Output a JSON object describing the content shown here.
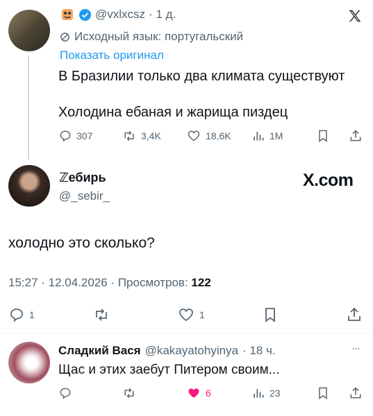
{
  "parent_tweet": {
    "handle": "@vxlxcsz",
    "time": "1 д.",
    "translated_label": "Исходный язык: португальский",
    "show_original": "Показать оригинал",
    "text_line1": "В Бразилии только два климата существуют",
    "text_line2": "Холодина ебаная и жарища пиздец",
    "replies": "307",
    "reposts": "3,4K",
    "likes": "18,6K",
    "views": "1M"
  },
  "main_tweet": {
    "name": "ℤебирь",
    "handle": "@_sebir_",
    "brand": "X.com",
    "text": "холодно это сколько?",
    "timestamp": "15:27 · 12.04.2026 · Просмотров: ",
    "views_count": "122",
    "replies": "1",
    "likes": "1"
  },
  "reply_tweet": {
    "name": "Сладкий Вася",
    "handle": "@kakayatohyinya",
    "time": "· 18 ч.",
    "text": "Щас и этих заебут Питером своим...",
    "likes": "6",
    "views": "23",
    "more": "···"
  },
  "colors": {
    "text": "#0f1419",
    "gray": "#536471",
    "link": "#1d9bf0",
    "like": "#f91880",
    "verified": "#1d9bf0"
  },
  "icons": [
    "x-logo-icon",
    "verified-icon",
    "translate-icon",
    "reply-icon",
    "repost-icon",
    "like-icon",
    "views-icon",
    "bookmark-icon",
    "share-icon",
    "more-icon"
  ]
}
